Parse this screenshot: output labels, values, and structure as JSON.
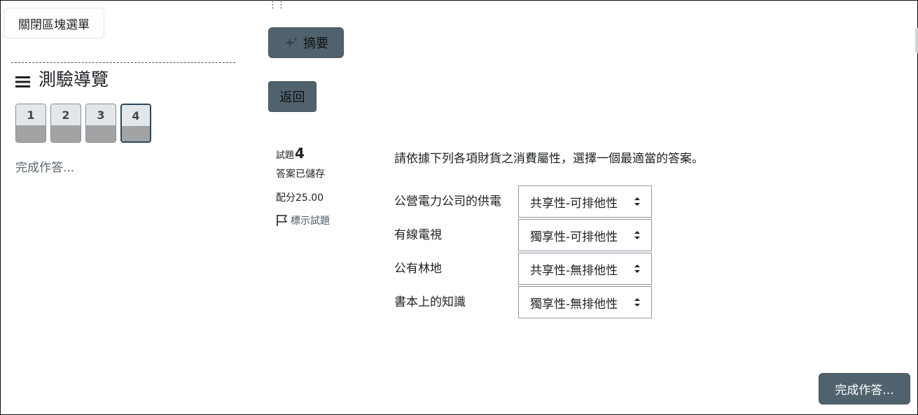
{
  "drawer": {
    "close_button_label": "關閉區塊選單",
    "nav_title": "測驗導覽",
    "questions": [
      {
        "number": "1",
        "current": false
      },
      {
        "number": "2",
        "current": false
      },
      {
        "number": "3",
        "current": false
      },
      {
        "number": "4",
        "current": true
      }
    ],
    "finish_link": "完成作答..."
  },
  "main": {
    "drag_handle": "⋮⋮",
    "summary_button_label": "摘要",
    "back_button_label": "返回",
    "question": {
      "number_label": "試題",
      "number": "4",
      "state": "答案已儲存",
      "grade_label": "配分25.00",
      "flag_label": "標示試題",
      "text": "請依據下列各項財貨之消費屬性，選擇一個最適當的答案。",
      "rows": [
        {
          "label": "公營電力公司的供電",
          "selected": "共享性-可排他性"
        },
        {
          "label": "有線電視",
          "selected": "獨享性-可排他性"
        },
        {
          "label": "公有林地",
          "selected": "共享性-無排他性"
        },
        {
          "label": "書本上的知識",
          "selected": "獨享性-無排他性"
        }
      ]
    },
    "finish_button_label": "完成作答..."
  },
  "colors": {
    "primary_button": "#50626d",
    "nav_answered": "#a1a3a5",
    "nav_current_border": "#28485f"
  }
}
